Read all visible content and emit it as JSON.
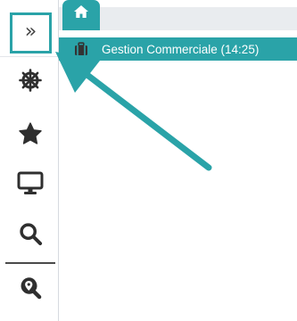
{
  "sidebar": {
    "expand_label": "»",
    "items": [
      {
        "icon": "ship-wheel-icon"
      },
      {
        "icon": "star-icon"
      },
      {
        "icon": "monitor-icon"
      },
      {
        "icon": "search-icon"
      },
      {
        "icon": "location-search-icon"
      }
    ]
  },
  "tabs": {
    "home_icon": "home-icon"
  },
  "module": {
    "icon": "briefcase-icon",
    "label": "Gestion Commerciale (14:25)"
  },
  "colors": {
    "accent": "#2aa3a8",
    "icon": "#2f2f2f",
    "tabbar": "#e9ecef"
  }
}
